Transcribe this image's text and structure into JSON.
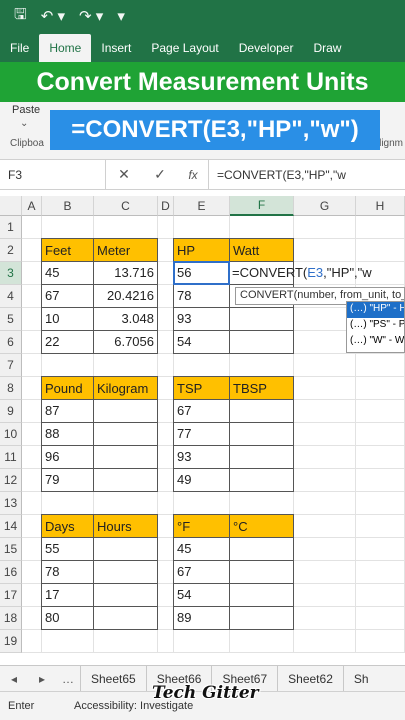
{
  "quick_access": {
    "save_icon": "save-icon",
    "undo_icon": "undo-icon",
    "redo_icon": "redo-icon",
    "more_icon": "more-icon"
  },
  "ribbon_tabs": [
    "File",
    "Home",
    "Insert",
    "Page Layout",
    "Developer",
    "Draw"
  ],
  "active_tab": "Home",
  "banner_title": "Convert Measurement Units",
  "ribbon": {
    "paste_label": "Paste",
    "clipboard_label": "Clipboa",
    "alignment_label": "Alignm"
  },
  "formula_banner": "=CONVERT(E3,\"HP\",\"w\")",
  "formula_bar": {
    "name_box": "F3",
    "cancel": "✕",
    "enter": "✓",
    "fx": "fx",
    "formula": "=CONVERT(E3,\"HP\",\"w"
  },
  "columns": [
    "A",
    "B",
    "C",
    "D",
    "E",
    "F",
    "G",
    "H"
  ],
  "rows": [
    "1",
    "2",
    "3",
    "4",
    "5",
    "6",
    "7",
    "8",
    "9",
    "10",
    "11",
    "12",
    "13",
    "14",
    "15",
    "16",
    "17",
    "18",
    "19"
  ],
  "tables": {
    "feet_meter": {
      "headers": [
        "Feet",
        "Meter"
      ],
      "rows": [
        [
          "45",
          "13.716"
        ],
        [
          "67",
          "20.4216"
        ],
        [
          "10",
          "3.048"
        ],
        [
          "22",
          "6.7056"
        ]
      ]
    },
    "hp_watt": {
      "headers": [
        "HP",
        "Watt"
      ],
      "rows": [
        [
          "56",
          ""
        ],
        [
          "78",
          ""
        ],
        [
          "93",
          ""
        ],
        [
          "54",
          ""
        ]
      ]
    },
    "pound_kilogram": {
      "headers": [
        "Pound",
        "Kilogram"
      ],
      "rows": [
        [
          "87",
          ""
        ],
        [
          "88",
          ""
        ],
        [
          "96",
          ""
        ],
        [
          "79",
          ""
        ]
      ]
    },
    "tsp_tbsp": {
      "headers": [
        "TSP",
        "TBSP"
      ],
      "rows": [
        [
          "67",
          ""
        ],
        [
          "77",
          ""
        ],
        [
          "93",
          ""
        ],
        [
          "49",
          ""
        ]
      ]
    },
    "days_hours": {
      "headers": [
        "Days",
        "Hours"
      ],
      "rows": [
        [
          "55",
          ""
        ],
        [
          "78",
          ""
        ],
        [
          "17",
          ""
        ],
        [
          "80",
          ""
        ]
      ]
    },
    "f_c": {
      "headers": [
        "°F",
        "°C"
      ],
      "rows": [
        [
          "45",
          ""
        ],
        [
          "67",
          ""
        ],
        [
          "54",
          ""
        ],
        [
          "89",
          ""
        ]
      ]
    }
  },
  "editing_cell": {
    "prefix": "=CONVERT(",
    "ref": "E3",
    "suffix": ",\"HP\",\"w"
  },
  "tooltip": "CONVERT(number, from_unit, to_unit)",
  "autocomplete": [
    "(…) \"HP\" - H",
    "(…) \"PS\" - P",
    "(…) \"W\" - W"
  ],
  "sheets": [
    "Sheet65",
    "Sheet66",
    "Sheet67",
    "Sheet62",
    "Sh"
  ],
  "status": {
    "mode": "Enter",
    "accessibility": "Accessibility: Investigate"
  },
  "watermark": "Tech Gitter"
}
